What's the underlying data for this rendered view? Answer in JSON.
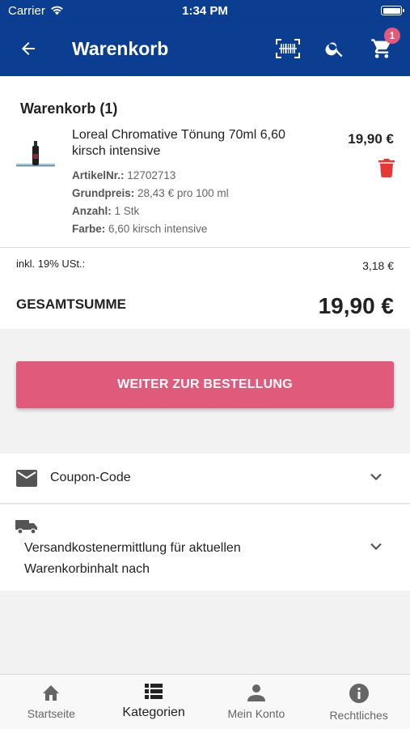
{
  "status_bar": {
    "carrier": "Carrier",
    "time": "1:34 PM"
  },
  "app_bar": {
    "title": "Warenkorb",
    "cart_count": "1"
  },
  "cart": {
    "heading": "Warenkorb (1)",
    "product": {
      "name": "Loreal Chromative Tönung 70ml 6,60 kirsch intensive",
      "price": "19,90 €",
      "article_label": "ArtikelNr.:",
      "article_value": "12702713",
      "base_price_label": "Grundpreis:",
      "base_price_value": "28,43 € pro 100 ml",
      "quantity_label": "Anzahl:",
      "quantity_value": "1 Stk",
      "color_label": "Farbe:",
      "color_value": "6,60 kirsch intensive"
    }
  },
  "totals": {
    "vat_label": "inkl. 19% USt.:",
    "vat_value": "3,18 €",
    "total_label": "GESAMTSUMME",
    "total_value": "19,90 €"
  },
  "checkout": {
    "label": "WEITER ZUR BESTELLUNG"
  },
  "coupon": {
    "label": "Coupon-Code"
  },
  "shipping": {
    "label_line1": "Versandkostenermittlung für aktuellen",
    "label_line2": "Warenkorbinhalt nach"
  },
  "tabs": [
    {
      "label": "Startseite",
      "icon": "home-icon"
    },
    {
      "label": "Kategorien",
      "icon": "list-icon"
    },
    {
      "label": "Mein Konto",
      "icon": "person-icon"
    },
    {
      "label": "Rechtliches",
      "icon": "info-icon"
    }
  ],
  "colors": {
    "primary": "#0b3d91",
    "accent": "#e05a7c",
    "delete": "#e53935"
  }
}
